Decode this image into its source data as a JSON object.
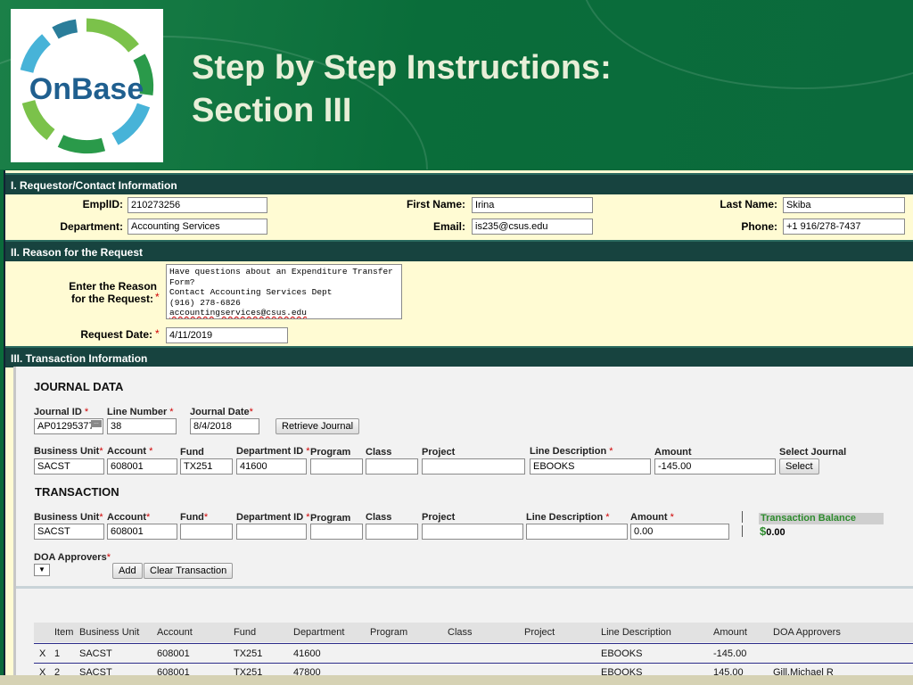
{
  "slide": {
    "logo_text": "OnBase",
    "title_line1": "Step by Step Instructions:",
    "title_line2": "Section III"
  },
  "section1": {
    "heading": "I. Requestor/Contact Information",
    "emplid_label": "EmplID:",
    "emplid_value": "210273256",
    "first_name_label": "First Name:",
    "first_name_value": "Irina",
    "last_name_label": "Last Name:",
    "last_name_value": "Skiba",
    "department_label": "Department:",
    "department_value": "Accounting Services",
    "email_label": "Email:",
    "email_value": "is235@csus.edu",
    "phone_label": "Phone:",
    "phone_value": "+1 916/278-7437"
  },
  "section2": {
    "heading": "II. Reason for the Request",
    "reason_label_1": "Enter the Reason",
    "reason_label_2": "for the Request:",
    "reason_text": "Have questions about an Expenditure Transfer\nForm?\nContact Accounting Services Dept\n(916) 278-6826\n",
    "reason_email": "accountingservices@csus.edu",
    "date_label": "Request Date:",
    "date_value": "4/11/2019",
    "required_mark": "*"
  },
  "section3": {
    "heading": "III. Transaction Information",
    "journal": {
      "heading": "JOURNAL DATA",
      "journal_id_label": "Journal ID",
      "journal_id_value": "AP01295377",
      "line_number_label": "Line Number",
      "line_number_value": "38",
      "journal_date_label": "Journal Date",
      "journal_date_value": "8/4/2018",
      "retrieve_button": "Retrieve Journal",
      "business_unit_label": "Business Unit",
      "business_unit_value": "SACST",
      "account_label": "Account",
      "account_value": "608001",
      "fund_label": "Fund",
      "fund_value": "TX251",
      "department_id_label": "Department ID",
      "department_id_value": "41600",
      "program_label": "Program",
      "program_value": "",
      "class_label": "Class",
      "class_value": "",
      "project_label": "Project",
      "project_value": "",
      "line_description_label": "Line Description",
      "line_description_value": "EBOOKS",
      "amount_label": "Amount",
      "amount_value": "-145.00",
      "select_journal_label": "Select Journal",
      "select_button": "Select"
    },
    "transaction": {
      "heading": "TRANSACTION",
      "business_unit_label": "Business Unit",
      "business_unit_value": "SACST",
      "account_label": "Account",
      "account_value": "608001",
      "fund_label": "Fund",
      "fund_value": "",
      "department_id_label": "Department ID",
      "department_id_value": "",
      "program_label": "Program",
      "program_value": "",
      "class_label": "Class",
      "class_value": "",
      "project_label": "Project",
      "project_value": "",
      "line_description_label": "Line Description",
      "line_description_value": "",
      "amount_label": "Amount",
      "amount_value": "0.00",
      "balance_label": "Transaction Balance",
      "balance_currency": "$",
      "balance_value": "0.00",
      "doa_label": "DOA Approvers",
      "doa_select_value": "",
      "add_button": "Add",
      "clear_button": "Clear Transaction"
    },
    "table": {
      "headers": [
        "Item",
        "Business Unit",
        "Account",
        "Fund",
        "Department",
        "Program",
        "Class",
        "Project",
        "Line Description",
        "Amount",
        "DOA Approvers"
      ],
      "rows": [
        {
          "delete": "X",
          "item": "1",
          "business_unit": "SACST",
          "account": "608001",
          "fund": "TX251",
          "department": "41600",
          "program": "",
          "class": "",
          "project": "",
          "line_description": "EBOOKS",
          "amount": "-145.00",
          "doa_approvers": ""
        },
        {
          "delete": "X",
          "item": "2",
          "business_unit": "SACST",
          "account": "608001",
          "fund": "TX251",
          "department": "47800",
          "program": "",
          "class": "",
          "project": "",
          "line_description": "EBOOKS",
          "amount": "145.00",
          "doa_approvers": "Gill,Michael R"
        }
      ]
    }
  },
  "colors": {
    "slide_green": "#0b6a3b",
    "title_text": "#e8efd8",
    "section_bar": "#17433f",
    "form_background": "#fffbd3",
    "required": "#d00000",
    "balance_green": "#2e8b2e"
  }
}
